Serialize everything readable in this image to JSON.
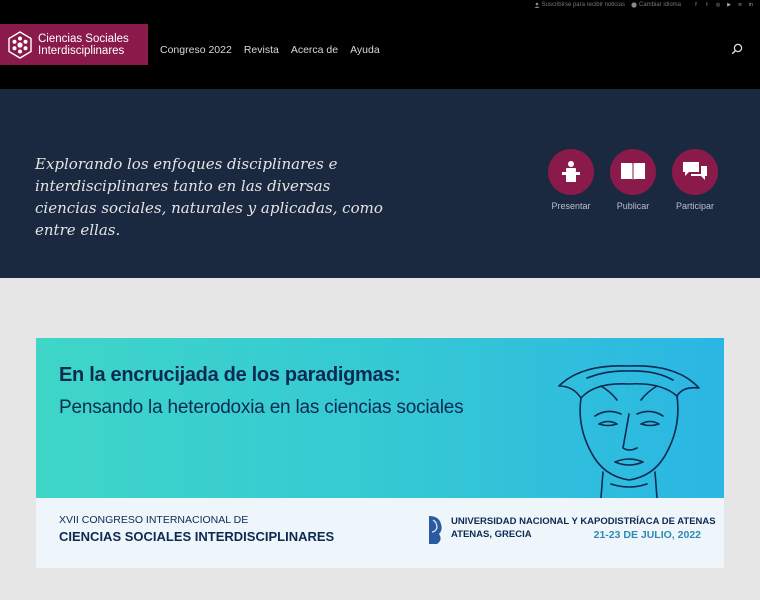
{
  "header": {
    "logo_line1": "Ciencias Sociales",
    "logo_line2": "Interdisciplinares",
    "nav": [
      "Congreso 2022",
      "Revista",
      "Acerca de",
      "Ayuda"
    ],
    "util": {
      "subscribe": "Suscribirse para recibir noticias",
      "language": "Cambiar idioma"
    },
    "social_icons": [
      "facebook-icon",
      "twitter-icon",
      "instagram-icon",
      "youtube-icon",
      "feed-icon",
      "linkedin-icon"
    ]
  },
  "hero": {
    "tagline": "Explorando los enfoques disciplinares e interdisciplinares tanto en las diversas ciencias sociales, naturales y aplicadas, como entre ellas.",
    "actions": [
      {
        "label": "Presentar",
        "icon": "podium-icon"
      },
      {
        "label": "Publicar",
        "icon": "book-icon"
      },
      {
        "label": "Participar",
        "icon": "chat-icon"
      }
    ]
  },
  "banner": {
    "title": "En la encrucijada de los paradigmas:",
    "subtitle": "Pensando la heterodoxia en las ciencias sociales",
    "congress_line1": "XVII CONGRESO INTERNACIONAL DE",
    "congress_line2": "CIENCIAS SOCIALES INTERDISCIPLINARES",
    "university": "UNIVERSIDAD NACIONAL Y KAPODISTRÍACA DE ATENAS",
    "city": "ATENAS, GRECIA",
    "dates": "21-23 DE JULIO, 2022"
  },
  "colors": {
    "brand": "#8a1a49",
    "hero_bg": "#1b2940",
    "banner_text": "#0c2a52",
    "date_accent": "#2c8ab5"
  }
}
